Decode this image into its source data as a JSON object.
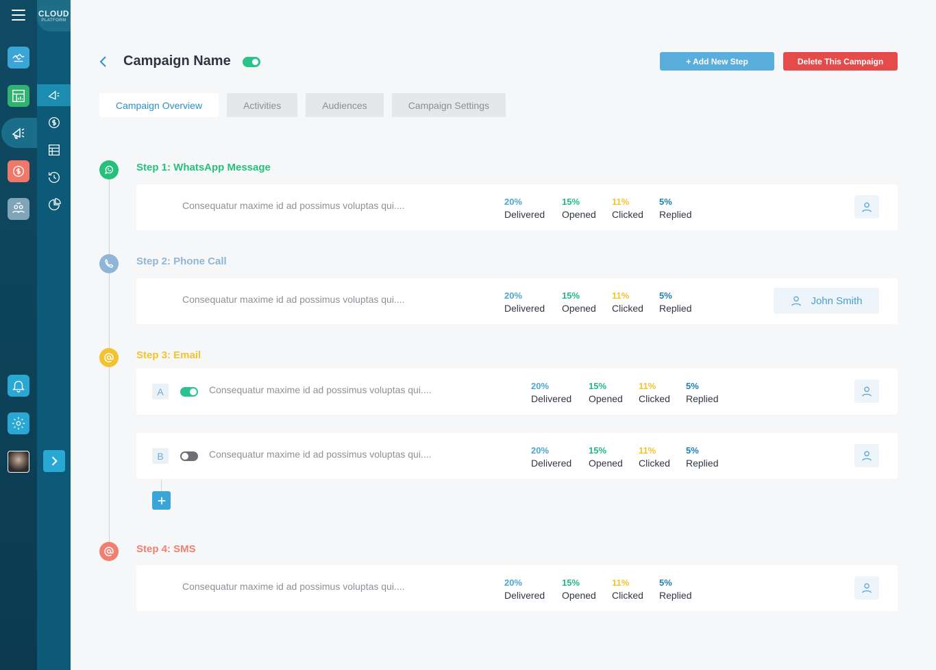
{
  "brand": {
    "line1": "CLOUD",
    "line2": "PLATFORM"
  },
  "header": {
    "title": "Campaign Name",
    "add_step_label": "+ Add New Step",
    "delete_label": "Delete This Campaign"
  },
  "tabs": [
    {
      "label": "Campaign Overview",
      "active": true
    },
    {
      "label": "Activities",
      "active": false
    },
    {
      "label": "Audiences",
      "active": false
    },
    {
      "label": "Campaign Settings",
      "active": false
    }
  ],
  "colors": {
    "whatsapp": "#25c17a",
    "phone": "#8fb6d6",
    "email": "#f2c230",
    "sms": "#f07f72",
    "accent": "#2c8fc4",
    "danger": "#e54b4b"
  },
  "steps": [
    {
      "title": "Step 1: WhatsApp Message",
      "icon": "whatsapp-icon",
      "cards": [
        {
          "description": "Consequatur maxime id ad possimus  voluptas qui....",
          "delivered_pct": "20%",
          "delivered_label": "Delivered",
          "opened_pct": "15%",
          "opened_label": "Opened",
          "clicked_pct": "11%",
          "clicked_label": "Clicked",
          "replied_pct": "5%",
          "replied_label": "Replied"
        }
      ]
    },
    {
      "title": "Step 2: Phone Call",
      "icon": "phone-icon",
      "assignee": "John Smith",
      "cards": [
        {
          "description": "Consequatur maxime id ad possimus  voluptas qui....",
          "delivered_pct": "20%",
          "delivered_label": "Delivered",
          "opened_pct": "15%",
          "opened_label": "Opened",
          "clicked_pct": "11%",
          "clicked_label": "Clicked",
          "replied_pct": "5%",
          "replied_label": "Replied"
        }
      ]
    },
    {
      "title": "Step 3: Email",
      "icon": "at-sign-icon",
      "cards": [
        {
          "variant": "A",
          "enabled": true,
          "description": "Consequatur maxime id ad possimus  voluptas qui....",
          "delivered_pct": "20%",
          "delivered_label": "Delivered",
          "opened_pct": "15%",
          "opened_label": "Opened",
          "clicked_pct": "11%",
          "clicked_label": "Clicked",
          "replied_pct": "5%",
          "replied_label": "Replied"
        },
        {
          "variant": "B",
          "enabled": false,
          "description": "Consequatur maxime id ad possimus  voluptas qui....",
          "delivered_pct": "20%",
          "delivered_label": "Delivered",
          "opened_pct": "15%",
          "opened_label": "Opened",
          "clicked_pct": "11%",
          "clicked_label": "Clicked",
          "replied_pct": "5%",
          "replied_label": "Replied"
        }
      ]
    },
    {
      "title": "Step 4: SMS",
      "icon": "at-sign-icon",
      "cards": [
        {
          "description": "Consequatur maxime id ad possimus  voluptas qui....",
          "delivered_pct": "20%",
          "delivered_label": "Delivered",
          "opened_pct": "15%",
          "opened_label": "Opened",
          "clicked_pct": "11%",
          "clicked_label": "Clicked",
          "replied_pct": "5%",
          "replied_label": "Replied"
        }
      ]
    }
  ],
  "rail_icons": [
    "menu-icon",
    "handshake-icon",
    "dashboard-chart-icon",
    "megaphone-icon",
    "dollar-refresh-icon",
    "people-exchange-icon",
    "bell-icon",
    "settings-gear-icon",
    "user-avatar"
  ],
  "secondary_icons": [
    "campaign-icon",
    "dollar-circle-icon",
    "table-icon",
    "history-icon",
    "pie-chart-icon",
    "chevron-right-icon"
  ]
}
